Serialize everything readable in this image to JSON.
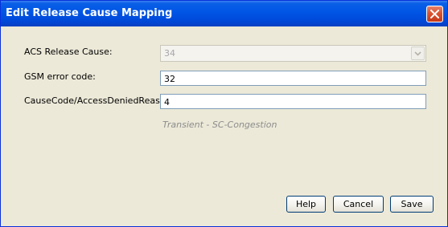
{
  "window": {
    "title": "Edit Release Cause Mapping"
  },
  "form": {
    "acs_release_cause_label": "ACS Release Cause:",
    "acs_release_cause_value": "34",
    "gsm_error_code_label": "GSM error code:",
    "gsm_error_code_value": "32",
    "cause_code_label": "CauseCode/AccessDeniedReason",
    "cause_code_value": "4",
    "description": "Transient - SC-Congestion"
  },
  "buttons": {
    "help": "Help",
    "cancel": "Cancel",
    "save": "Save"
  },
  "colors": {
    "titlebar": "#0055e5",
    "background": "#ece9d8",
    "close_button": "#d9542f",
    "input_border": "#7f9db9"
  },
  "icons": {
    "close": "close-icon",
    "dropdown": "chevron-down-icon"
  }
}
